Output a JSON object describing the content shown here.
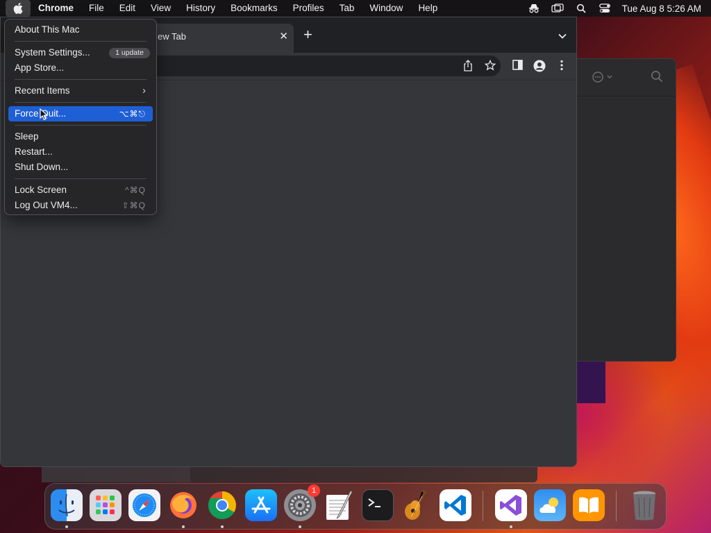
{
  "menubar": {
    "app_name": "Chrome",
    "items": [
      "File",
      "Edit",
      "View",
      "History",
      "Bookmarks",
      "Profiles",
      "Tab",
      "Window",
      "Help"
    ],
    "clock": "Tue Aug 8  5:26 AM",
    "status_icons": [
      "incognito-icon",
      "screen-mirroring-icon",
      "spotlight-search-icon",
      "control-center-icon"
    ]
  },
  "apple_menu": {
    "items": [
      {
        "label": "About This Mac"
      },
      {
        "label": "System Settings...",
        "badge": "1 update"
      },
      {
        "label": "App Store..."
      },
      {
        "label": "Recent Items",
        "submenu": true
      },
      {
        "label": "Force Quit...",
        "shortcut": "⌥⌘⎋",
        "highlighted": true
      },
      {
        "label": "Sleep"
      },
      {
        "label": "Restart..."
      },
      {
        "label": "Shut Down..."
      },
      {
        "label": "Lock Screen",
        "shortcut": "^⌘Q"
      },
      {
        "label": "Log Out VM4...",
        "shortcut": "⇧⌘Q"
      }
    ]
  },
  "chrome": {
    "tab_title": "ew Tab",
    "tab_close": "✕",
    "new_tab": "+"
  },
  "dock": {
    "apps": [
      "Finder",
      "Launchpad",
      "Safari",
      "Firefox",
      "Chrome",
      "App Store",
      "System Settings",
      "TextEdit",
      "Terminal",
      "GarageBand",
      "Visual Studio Code",
      "Visual Studio",
      "Weather",
      "Books",
      "Trash"
    ],
    "system_settings_badge": "1"
  },
  "colors": {
    "menu_highlight": "#1f5fd6",
    "badge_red": "#ff3b30"
  }
}
